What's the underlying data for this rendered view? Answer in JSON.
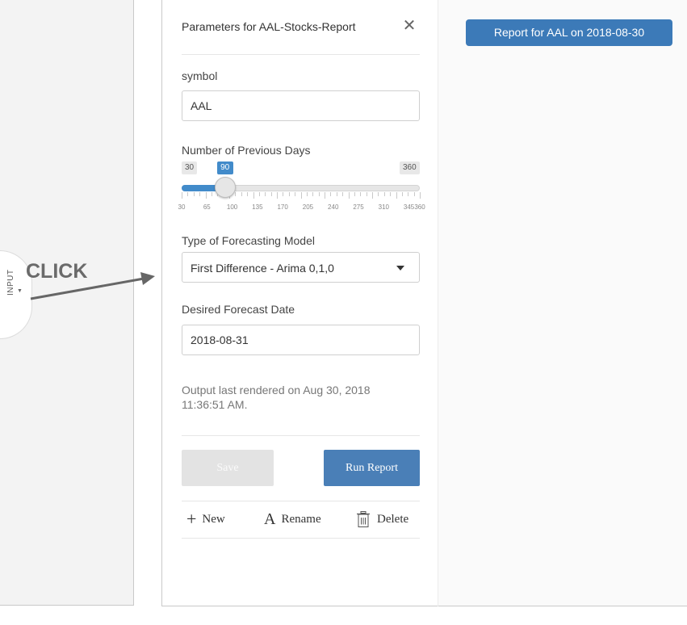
{
  "sidebar": {
    "tab_label": "INPUT"
  },
  "annotation": {
    "click_text": "CLICK"
  },
  "panel": {
    "title": "Parameters for AAL-Stocks-Report",
    "close_icon": "close-icon",
    "symbol": {
      "label": "symbol",
      "value": "AAL"
    },
    "days": {
      "label": "Number of Previous Days",
      "min": "30",
      "max": "360",
      "value": "90",
      "min_num": 30,
      "max_num": 360,
      "value_num": 90,
      "tick_labels": [
        "30",
        "65",
        "100",
        "135",
        "170",
        "205",
        "240",
        "275",
        "310",
        "345",
        "360"
      ]
    },
    "model": {
      "label": "Type of Forecasting Model",
      "value": "First Difference - Arima 0,1,0"
    },
    "date": {
      "label": "Desired Forecast Date",
      "value": "2018-08-31"
    },
    "status": "Output last rendered on Aug 30, 2018 11:36:51 AM.",
    "buttons": {
      "save": "Save",
      "run": "Run Report"
    },
    "actions": {
      "new": "New",
      "rename": "Rename",
      "delete": "Delete"
    }
  },
  "report": {
    "button_label": "Report for AAL on 2018-08-30"
  },
  "colors": {
    "accent": "#428bca",
    "run_button": "#4a7fb7",
    "report_button": "#3c7ab8"
  }
}
